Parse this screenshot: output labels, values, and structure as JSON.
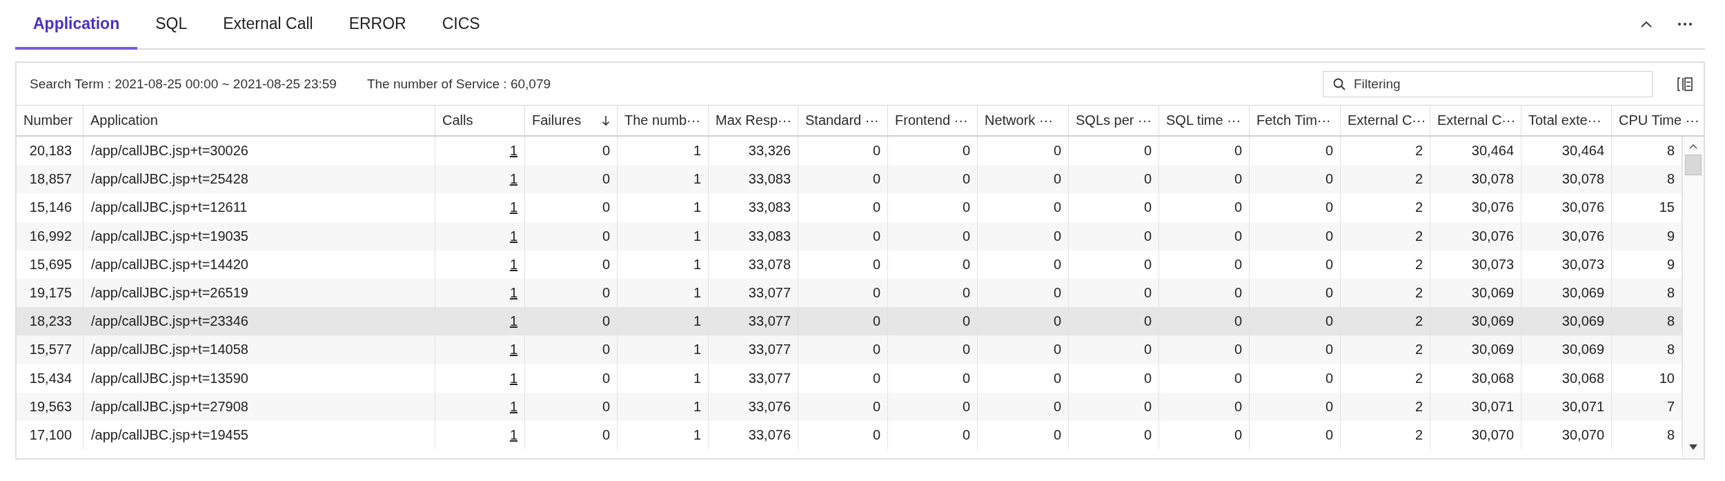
{
  "tabs": [
    {
      "label": "Application",
      "selected": true
    },
    {
      "label": "SQL",
      "selected": false
    },
    {
      "label": "External Call",
      "selected": false
    },
    {
      "label": "ERROR",
      "selected": false
    },
    {
      "label": "CICS",
      "selected": false
    }
  ],
  "toolbar": {
    "search_term": "Search Term : 2021-08-25 00:00 ~ 2021-08-25 23:59",
    "service_count": "The number of Service : 60,079",
    "filter": {
      "placeholder": "Filtering"
    }
  },
  "table": {
    "columns": [
      {
        "label": "Number",
        "kind": "number",
        "sorted": false
      },
      {
        "label": "Application",
        "kind": "text",
        "sorted": false
      },
      {
        "label": "Calls",
        "kind": "link",
        "sorted": false
      },
      {
        "label": "Failures",
        "kind": "number",
        "sorted": true
      },
      {
        "label": "The numb···",
        "kind": "number",
        "sorted": false
      },
      {
        "label": "Max Resp···",
        "kind": "number",
        "sorted": false
      },
      {
        "label": "Standard ···",
        "kind": "number",
        "sorted": false
      },
      {
        "label": "Frontend ···",
        "kind": "number",
        "sorted": false
      },
      {
        "label": "Network ···",
        "kind": "number",
        "sorted": false
      },
      {
        "label": "SQLs per ···",
        "kind": "number",
        "sorted": false
      },
      {
        "label": "SQL time ···",
        "kind": "number",
        "sorted": false
      },
      {
        "label": "Fetch Tim···",
        "kind": "number",
        "sorted": false
      },
      {
        "label": "External C···",
        "kind": "number",
        "sorted": false
      },
      {
        "label": "External C···",
        "kind": "number",
        "sorted": false
      },
      {
        "label": "Total exte···",
        "kind": "number",
        "sorted": false
      },
      {
        "label": "CPU Time ···",
        "kind": "number",
        "sorted": false
      }
    ],
    "rows": [
      {
        "hovered": false,
        "cells": [
          "20,183",
          "/app/callJBC.jsp+t=30026",
          "1",
          "0",
          "1",
          "33,326",
          "0",
          "0",
          "0",
          "0",
          "0",
          "0",
          "2",
          "30,464",
          "30,464",
          "8"
        ]
      },
      {
        "hovered": false,
        "cells": [
          "18,857",
          "/app/callJBC.jsp+t=25428",
          "1",
          "0",
          "1",
          "33,083",
          "0",
          "0",
          "0",
          "0",
          "0",
          "0",
          "2",
          "30,078",
          "30,078",
          "8"
        ]
      },
      {
        "hovered": false,
        "cells": [
          "15,146",
          "/app/callJBC.jsp+t=12611",
          "1",
          "0",
          "1",
          "33,083",
          "0",
          "0",
          "0",
          "0",
          "0",
          "0",
          "2",
          "30,076",
          "30,076",
          "15"
        ]
      },
      {
        "hovered": false,
        "cells": [
          "16,992",
          "/app/callJBC.jsp+t=19035",
          "1",
          "0",
          "1",
          "33,083",
          "0",
          "0",
          "0",
          "0",
          "0",
          "0",
          "2",
          "30,076",
          "30,076",
          "9"
        ]
      },
      {
        "hovered": false,
        "cells": [
          "15,695",
          "/app/callJBC.jsp+t=14420",
          "1",
          "0",
          "1",
          "33,078",
          "0",
          "0",
          "0",
          "0",
          "0",
          "0",
          "2",
          "30,073",
          "30,073",
          "9"
        ]
      },
      {
        "hovered": false,
        "cells": [
          "19,175",
          "/app/callJBC.jsp+t=26519",
          "1",
          "0",
          "1",
          "33,077",
          "0",
          "0",
          "0",
          "0",
          "0",
          "0",
          "2",
          "30,069",
          "30,069",
          "8"
        ]
      },
      {
        "hovered": true,
        "cells": [
          "18,233",
          "/app/callJBC.jsp+t=23346",
          "1",
          "0",
          "1",
          "33,077",
          "0",
          "0",
          "0",
          "0",
          "0",
          "0",
          "2",
          "30,069",
          "30,069",
          "8"
        ]
      },
      {
        "hovered": false,
        "cells": [
          "15,577",
          "/app/callJBC.jsp+t=14058",
          "1",
          "0",
          "1",
          "33,077",
          "0",
          "0",
          "0",
          "0",
          "0",
          "0",
          "2",
          "30,069",
          "30,069",
          "8"
        ]
      },
      {
        "hovered": false,
        "cells": [
          "15,434",
          "/app/callJBC.jsp+t=13590",
          "1",
          "0",
          "1",
          "33,077",
          "0",
          "0",
          "0",
          "0",
          "0",
          "0",
          "2",
          "30,068",
          "30,068",
          "10"
        ]
      },
      {
        "hovered": false,
        "cells": [
          "19,563",
          "/app/callJBC.jsp+t=27908",
          "1",
          "0",
          "1",
          "33,076",
          "0",
          "0",
          "0",
          "0",
          "0",
          "0",
          "2",
          "30,071",
          "30,071",
          "7"
        ]
      },
      {
        "hovered": false,
        "cells": [
          "17,100",
          "/app/callJBC.jsp+t=19455",
          "1",
          "0",
          "1",
          "33,076",
          "0",
          "0",
          "0",
          "0",
          "0",
          "0",
          "2",
          "30,070",
          "30,070",
          "8"
        ]
      }
    ]
  }
}
